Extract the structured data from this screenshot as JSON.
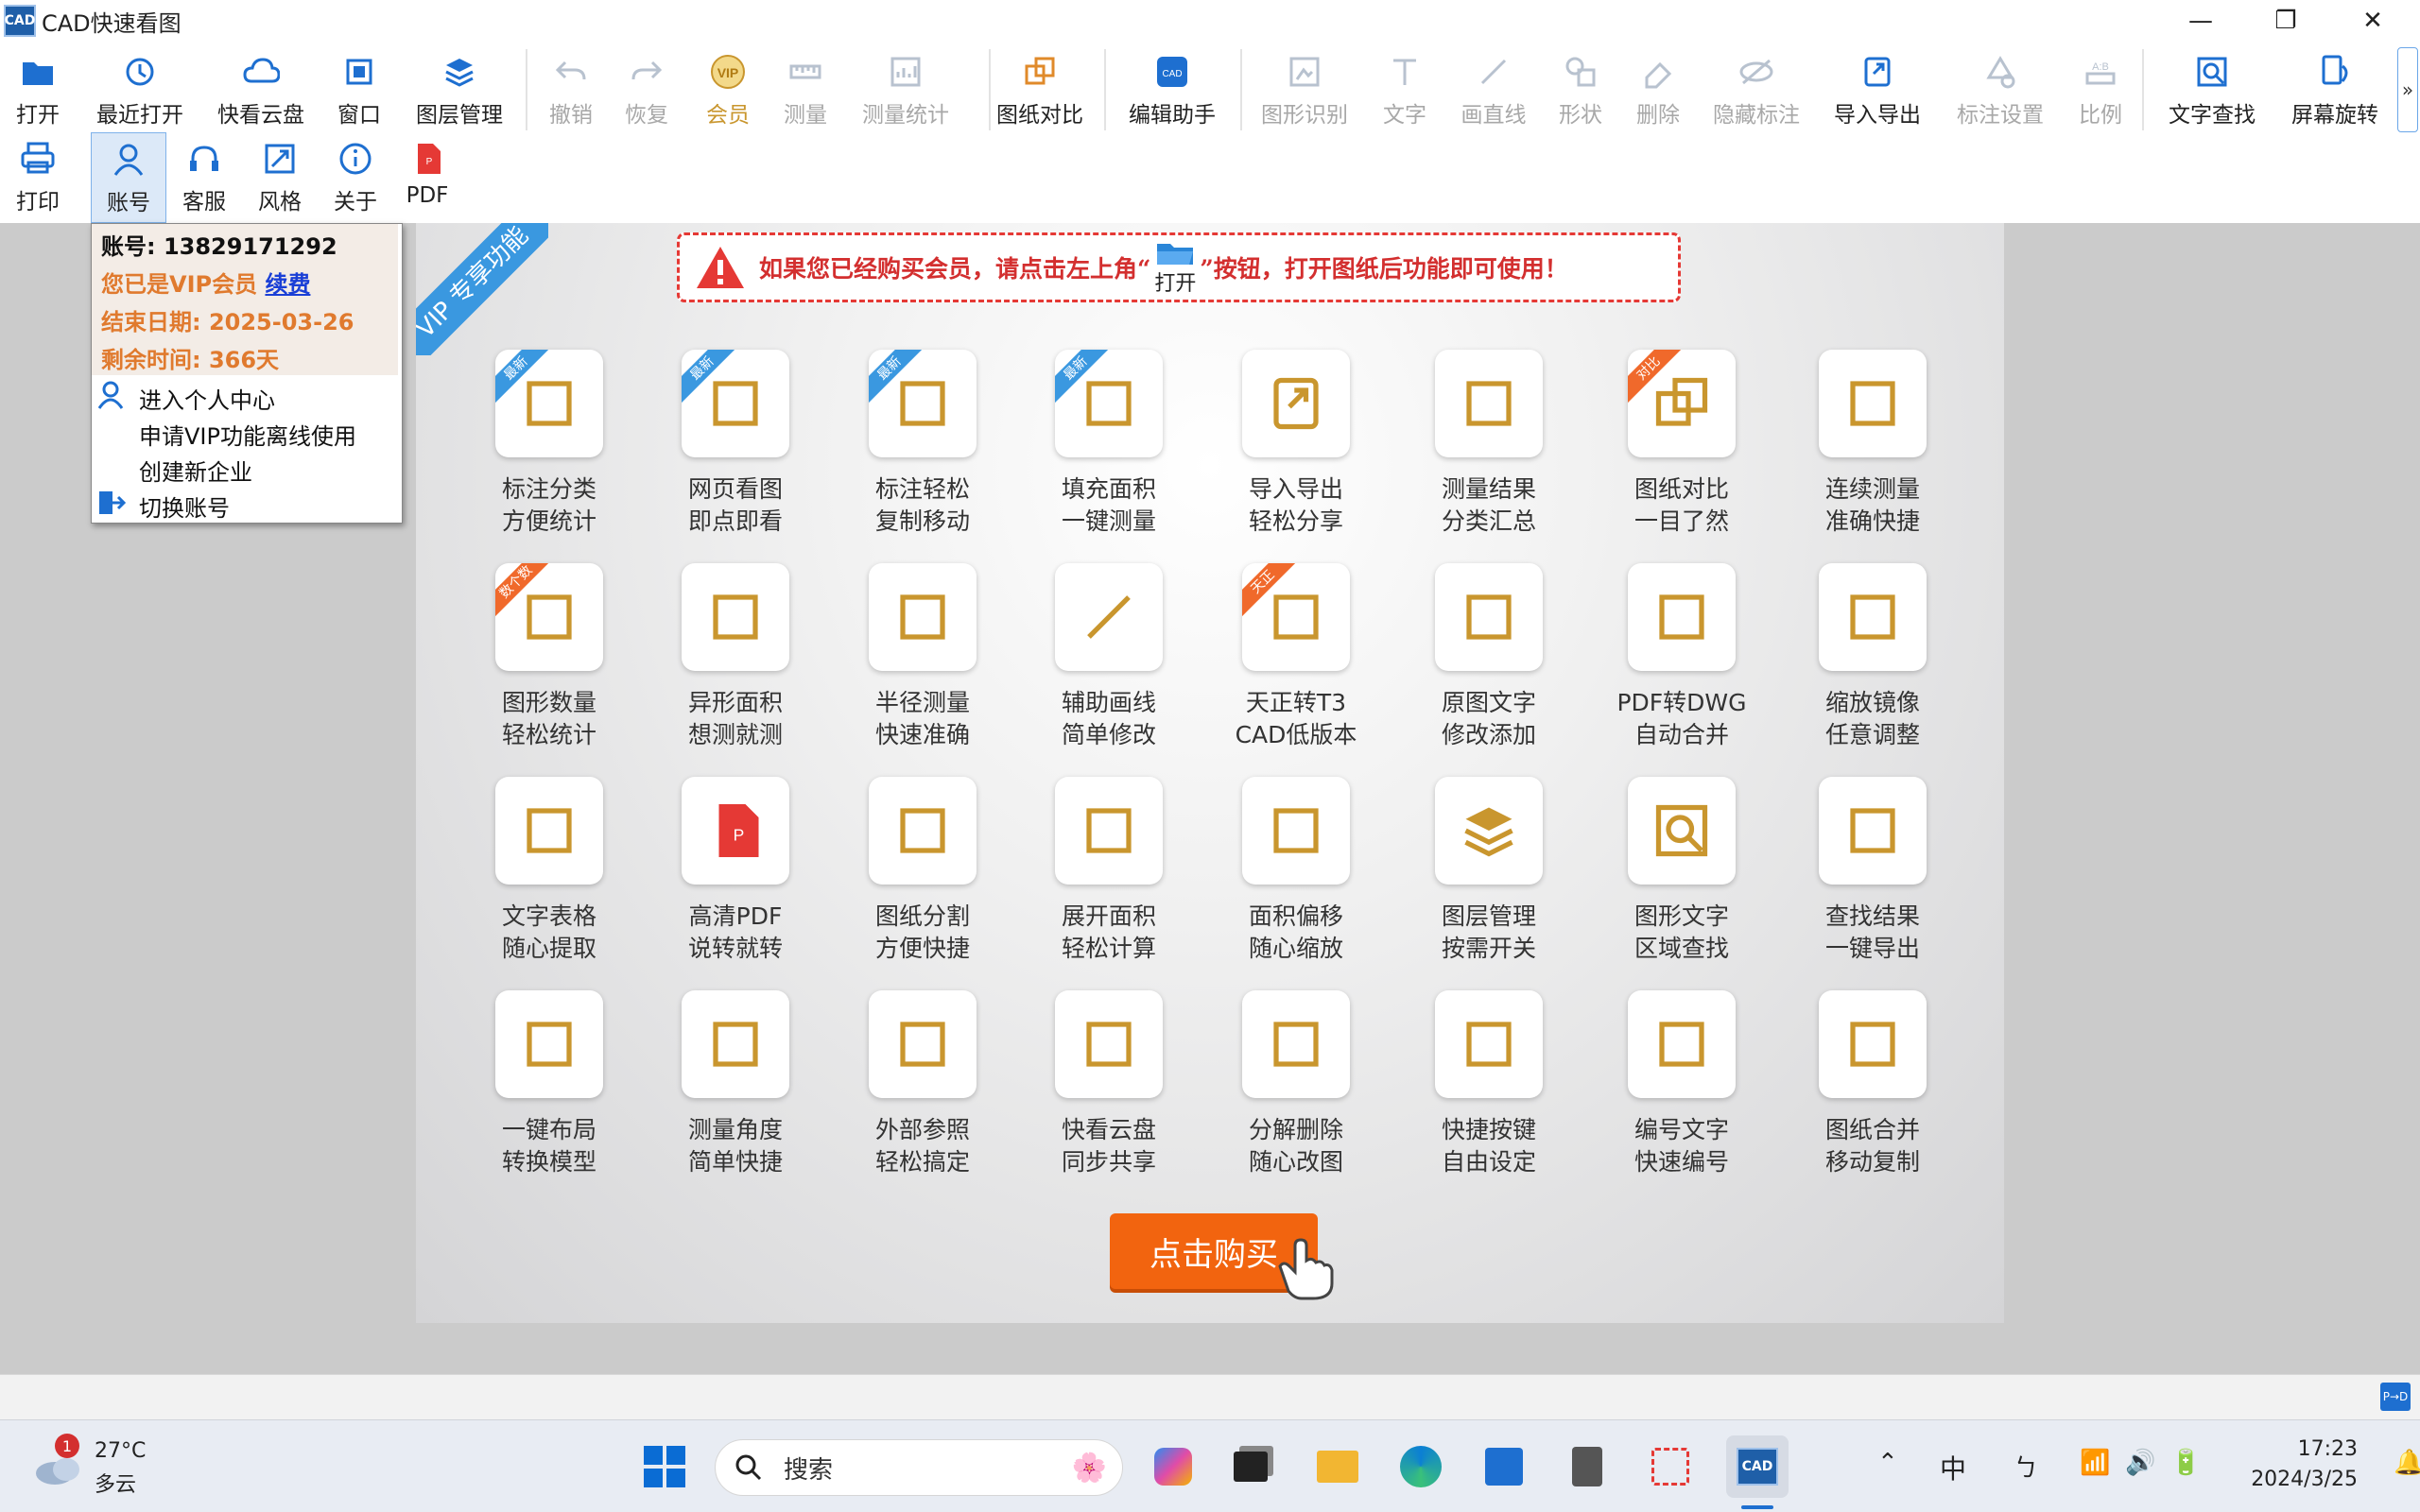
{
  "window": {
    "title": "CAD快速看图",
    "logo_text": "CAD",
    "minimize": "—",
    "maximize": "❐",
    "close": "✕"
  },
  "toolbar": {
    "row1": [
      {
        "label": "打开",
        "icon": "folder-open-icon"
      },
      {
        "label": "最近打开",
        "icon": "history-icon"
      },
      {
        "label": "快看云盘",
        "icon": "cloud-icon"
      },
      {
        "label": "窗口",
        "icon": "window-icon"
      },
      {
        "label": "图层管理",
        "icon": "layers-icon"
      },
      {
        "label": "撤销",
        "icon": "undo-icon"
      },
      {
        "label": "恢复",
        "icon": "redo-icon"
      },
      {
        "label": "会员",
        "icon": "vip-icon"
      },
      {
        "label": "测量",
        "icon": "measure-icon"
      },
      {
        "label": "测量统计",
        "icon": "measure-stats-icon"
      },
      {
        "label": "图纸对比",
        "icon": "compare-icon"
      },
      {
        "label": "编辑助手",
        "icon": "edit-assistant-icon"
      },
      {
        "label": "图形识别",
        "icon": "shape-recognize-icon"
      },
      {
        "label": "文字",
        "icon": "text-icon"
      },
      {
        "label": "画直线",
        "icon": "line-icon"
      },
      {
        "label": "形状",
        "icon": "shape-icon"
      },
      {
        "label": "删除",
        "icon": "eraser-icon"
      },
      {
        "label": "隐藏标注",
        "icon": "hide-annotation-icon"
      },
      {
        "label": "导入导出",
        "icon": "import-export-icon"
      },
      {
        "label": "标注设置",
        "icon": "annotation-settings-icon"
      },
      {
        "label": "比例",
        "icon": "scale-icon"
      },
      {
        "label": "文字查找",
        "icon": "text-search-icon"
      },
      {
        "label": "屏幕旋转",
        "icon": "rotate-screen-icon"
      }
    ],
    "more": "»",
    "row2": [
      {
        "label": "打印",
        "icon": "printer-icon"
      },
      {
        "label": "账号",
        "icon": "account-icon"
      },
      {
        "label": "客服",
        "icon": "headset-icon"
      },
      {
        "label": "风格",
        "icon": "style-icon"
      },
      {
        "label": "关于",
        "icon": "info-icon"
      },
      {
        "label": "PDF",
        "icon": "pdf-icon"
      }
    ]
  },
  "account_menu": {
    "account_line": "账号: 13829171292",
    "vip_text": "您已是VIP会员",
    "renew_link": "续费",
    "end_date": "结束日期: 2025-03-26",
    "remaining": "剩余时间: 366天",
    "items": [
      "进入个人中心",
      "申请VIP功能离线使用",
      "创建新企业",
      "切换账号"
    ]
  },
  "promo": {
    "corner_text": "VIP 专享功能",
    "notice_pre": "如果您已经购买会员，请点击左上角“",
    "notice_btn": "打开",
    "notice_post": "”按钮，打开图纸后功能即可使用！",
    "features": [
      {
        "l1": "标注分类",
        "l2": "方便统计",
        "tag": "最新",
        "icon": "category-icon"
      },
      {
        "l1": "网页看图",
        "l2": "即点即看",
        "tag": "最新",
        "icon": "web-view-icon"
      },
      {
        "l1": "标注轻松",
        "l2": "复制移动",
        "tag": "最新",
        "icon": "move-icon"
      },
      {
        "l1": "填充面积",
        "l2": "一键测量",
        "tag": "最新",
        "icon": "fill-area-icon"
      },
      {
        "l1": "导入导出",
        "l2": "轻松分享",
        "tag": "",
        "icon": "import-export-icon"
      },
      {
        "l1": "测量结果",
        "l2": "分类汇总",
        "tag": "",
        "icon": "measure-summary-icon"
      },
      {
        "l1": "图纸对比",
        "l2": "一目了然",
        "tag": "对比",
        "icon": "compare-icon"
      },
      {
        "l1": "连续测量",
        "l2": "准确快捷",
        "tag": "",
        "icon": "continuous-measure-icon"
      },
      {
        "l1": "图形数量",
        "l2": "轻松统计",
        "tag": "数个数",
        "icon": "shape-count-icon"
      },
      {
        "l1": "异形面积",
        "l2": "想测就测",
        "tag": "",
        "icon": "irregular-area-icon"
      },
      {
        "l1": "半径测量",
        "l2": "快速准确",
        "tag": "",
        "icon": "radius-icon"
      },
      {
        "l1": "辅助画线",
        "l2": "简单修改",
        "tag": "",
        "icon": "line-icon"
      },
      {
        "l1": "天正转T3",
        "l2": "CAD低版本",
        "tag": "天正",
        "icon": "convert-icon"
      },
      {
        "l1": "原图文字",
        "l2": "修改添加",
        "tag": "",
        "icon": "pen-icon"
      },
      {
        "l1": "PDF转DWG",
        "l2": "自动合并",
        "tag": "",
        "icon": "pdf-to-dwg-icon"
      },
      {
        "l1": "缩放镜像",
        "l2": "任意调整",
        "tag": "",
        "icon": "mirror-icon"
      },
      {
        "l1": "文字表格",
        "l2": "随心提取",
        "tag": "",
        "icon": "table-icon"
      },
      {
        "l1": "高清PDF",
        "l2": "说转就转",
        "tag": "",
        "icon": "pdf-icon"
      },
      {
        "l1": "图纸分割",
        "l2": "方便快捷",
        "tag": "",
        "icon": "split-icon"
      },
      {
        "l1": "展开面积",
        "l2": "轻松计算",
        "tag": "",
        "icon": "cube-icon"
      },
      {
        "l1": "面积偏移",
        "l2": "随心缩放",
        "tag": "",
        "icon": "area-offset-icon"
      },
      {
        "l1": "图层管理",
        "l2": "按需开关",
        "tag": "",
        "icon": "layers-icon"
      },
      {
        "l1": "图形文字",
        "l2": "区域查找",
        "tag": "",
        "icon": "text-search-icon"
      },
      {
        "l1": "查找结果",
        "l2": "一键导出",
        "tag": "",
        "icon": "export-excel-icon"
      },
      {
        "l1": "一键布局",
        "l2": "转换模型",
        "tag": "",
        "icon": "layout-cloud-icon"
      },
      {
        "l1": "测量角度",
        "l2": "简单快捷",
        "tag": "",
        "icon": "angle-icon"
      },
      {
        "l1": "外部参照",
        "l2": "轻松搞定",
        "tag": "",
        "icon": "dwg-ref-icon"
      },
      {
        "l1": "快看云盘",
        "l2": "同步共享",
        "tag": "",
        "icon": "cloud-sync-icon"
      },
      {
        "l1": "分解删除",
        "l2": "随心改图",
        "tag": "",
        "icon": "explode-icon"
      },
      {
        "l1": "快捷按键",
        "l2": "自由设定",
        "tag": "",
        "icon": "keyboard-icon"
      },
      {
        "l1": "编号文字",
        "l2": "快速编号",
        "tag": "",
        "icon": "numbering-icon"
      },
      {
        "l1": "图纸合并",
        "l2": "移动复制",
        "tag": "",
        "icon": "merge-icon"
      }
    ],
    "buy_button": "点击购买"
  },
  "statusbar": {
    "badge": "P→D"
  },
  "taskbar": {
    "weather_temp": "27°C",
    "weather_desc": "多云",
    "weather_badge": "1",
    "search_placeholder": "搜索",
    "ime": "中",
    "ime2": "ㄅ",
    "time": "17:23",
    "date": "2024/3/25"
  },
  "colors": {
    "accent": "#1e6fd0",
    "gold": "#c9962e",
    "vip_orange": "#e07a2e",
    "buy_orange": "#f2640f",
    "notice_red": "#d32f2f"
  }
}
